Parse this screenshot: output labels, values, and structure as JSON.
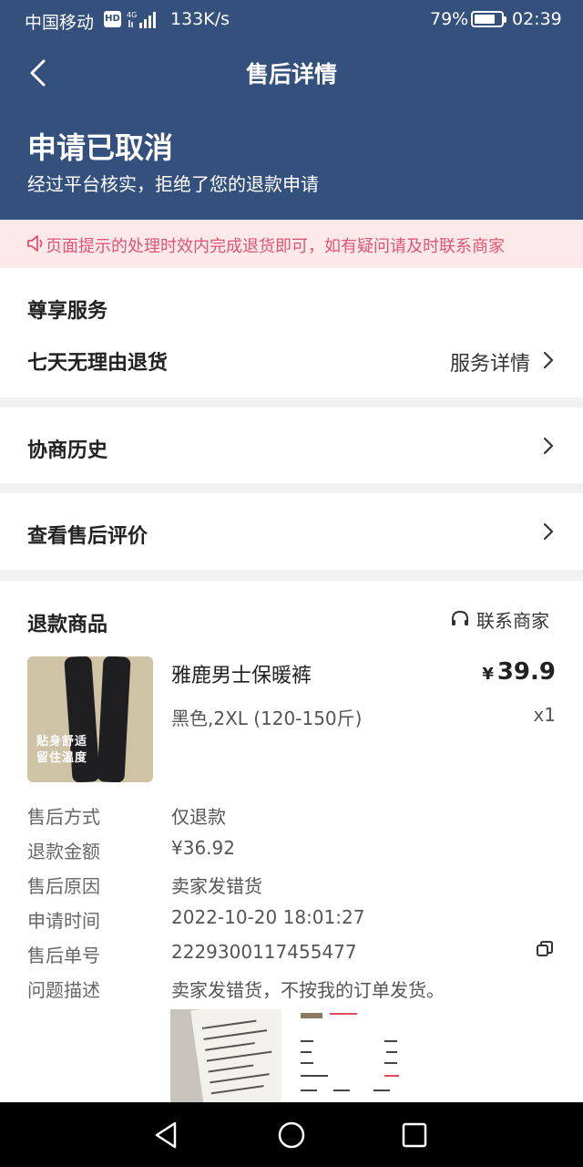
{
  "status_bar": {
    "carrier": "中国移动",
    "hd": "HD",
    "speed": "133K/s",
    "battery_pct": "79%",
    "battery_level": 0.79,
    "time": "02:39"
  },
  "header": {
    "back_icon": "chevron-left-icon",
    "title": "售后详情",
    "status": "申请已取消",
    "status_sub": "经过平台核实，拒绝了您的退款申请"
  },
  "notice": {
    "icon": "speaker-icon",
    "text": "页面提示的处理时效内完成退货即可，如有疑问请及时联系商家"
  },
  "service": {
    "title": "尊享服务",
    "item": "七天无理由退货",
    "detail_link": "服务详情"
  },
  "history": {
    "label": "协商历史"
  },
  "review": {
    "label": "查看售后评价"
  },
  "product": {
    "section_title": "退款商品",
    "contact_label": "联系商家",
    "contact_icon": "headset-icon",
    "thumb_caption1": "贴身舒适",
    "thumb_caption2": "留住温度",
    "name": "雅鹿男士保暖裤",
    "price_currency": "¥",
    "price": "39.9",
    "spec": "黑色,2XL (120-150斤)",
    "qty": "x1"
  },
  "info": [
    {
      "label": "售后方式",
      "value": "仅退款"
    },
    {
      "label": "退款金额",
      "value": "¥36.92"
    },
    {
      "label": "售后原因",
      "value": "卖家发错货"
    },
    {
      "label": "申请时间",
      "value": "2022-10-20 18:01:27"
    },
    {
      "label": "售后单号",
      "value": "2229300117455477"
    },
    {
      "label": "问题描述",
      "value": "卖家发错货，不按我的订单发货。"
    }
  ],
  "nav": {
    "back_icon": "triangle-back-icon",
    "home_icon": "circle-home-icon",
    "recent_icon": "square-recent-icon"
  }
}
